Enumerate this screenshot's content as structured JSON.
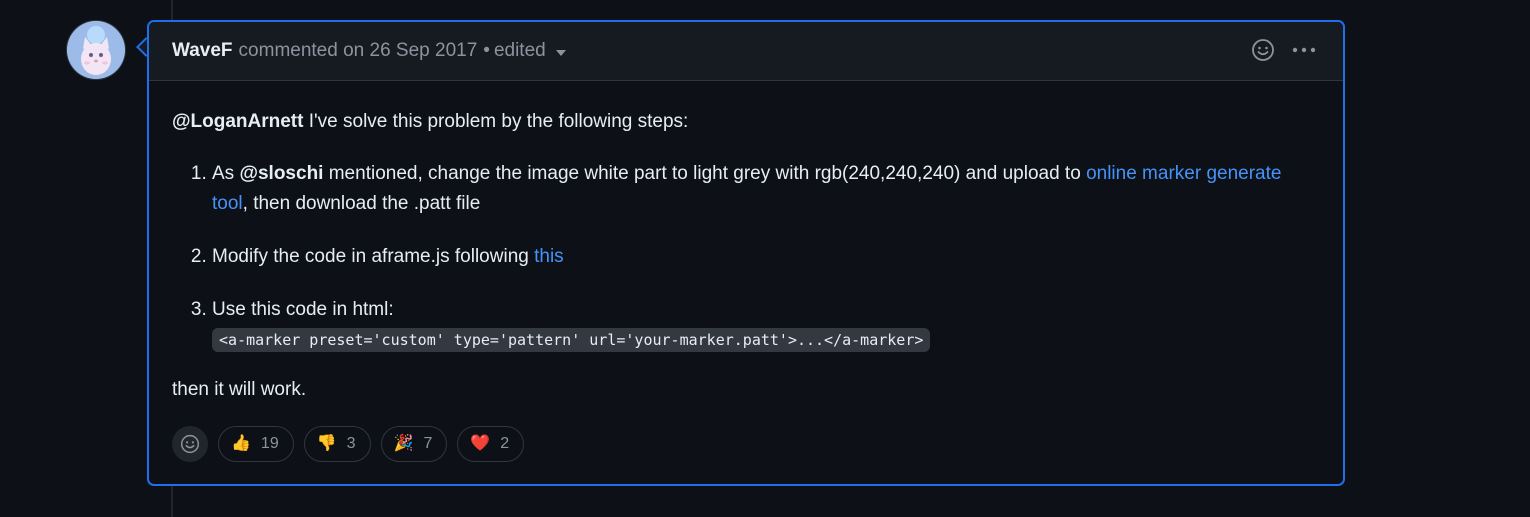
{
  "comment": {
    "author": "WaveF",
    "header_text": "commented on 26 Sep 2017",
    "separator": "•",
    "edited_label": "edited",
    "intro_mention": "@LoganArnett",
    "intro_text": " I've solve this problem by the following steps:",
    "steps": [
      {
        "prefix": "As ",
        "mention": "@sloschi",
        "text": " mentioned, change the image white part to light grey with rgb(240,240,240) and upload to ",
        "link": "online marker generate tool",
        "suffix": ", then download the .patt file"
      },
      {
        "text": "Modify the code in aframe.js following ",
        "link": "this"
      },
      {
        "text": "Use this code in html:",
        "code": "<a-marker preset='custom' type='pattern' url='your-marker.patt'>...</a-marker>"
      }
    ],
    "outro": "then it will work."
  },
  "reactions": [
    {
      "emoji": "👍",
      "icon": "thumbs-up-icon",
      "count": "19"
    },
    {
      "emoji": "👎",
      "icon": "thumbs-down-icon",
      "count": "3"
    },
    {
      "emoji": "🎉",
      "icon": "party-popper-icon",
      "count": "7"
    },
    {
      "emoji": "❤️",
      "icon": "heart-icon",
      "count": "2"
    }
  ],
  "colors": {
    "accent": "#1f6feb",
    "link": "#4493f8",
    "background": "#0d1117",
    "header_bg": "#161b22"
  }
}
